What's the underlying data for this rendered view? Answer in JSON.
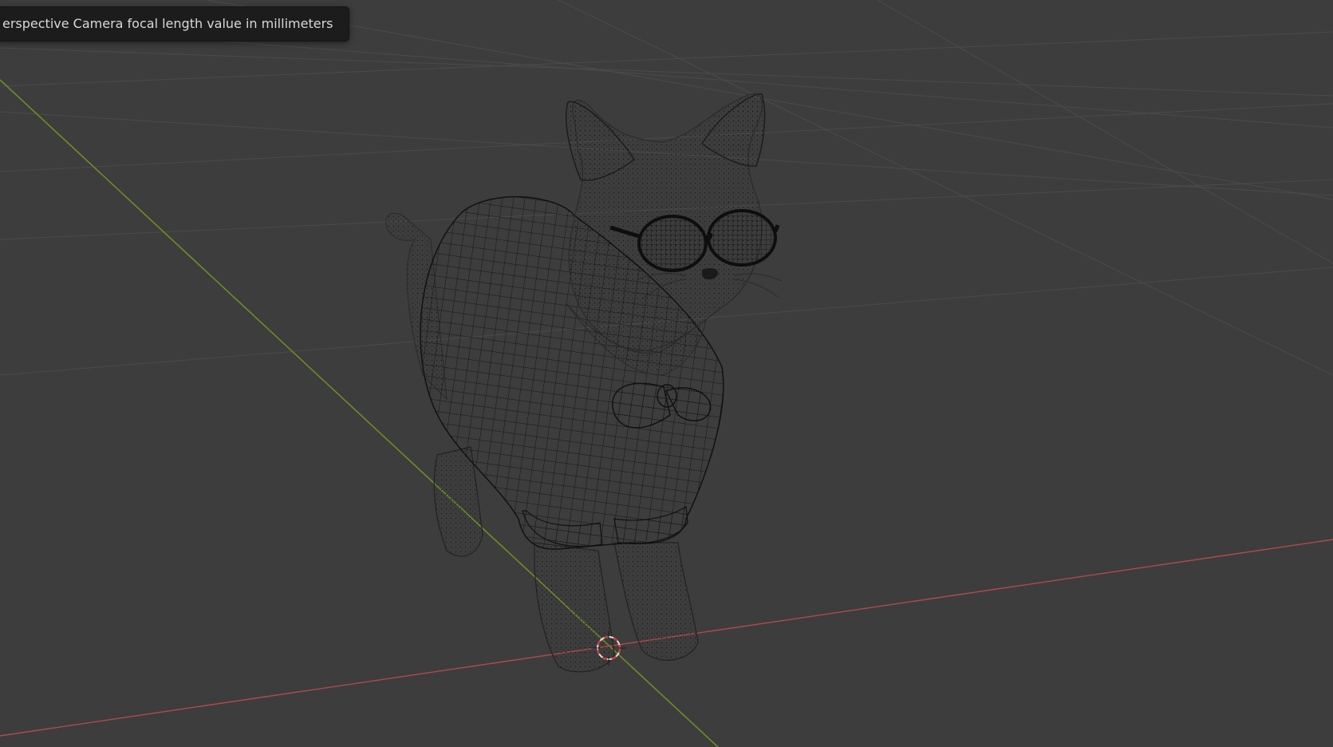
{
  "app": "Blender",
  "viewport": {
    "mode": "3d-viewport-wireframe",
    "background_color": "#3d3d3d",
    "grid_color": "#4a4a4a",
    "x_axis_color": "#b04a4a",
    "y_axis_color": "#6b8e23",
    "wire_color": "#151515",
    "object_name": "cat-with-sunglasses-and-bowtie",
    "cursor_icon": "3d-cursor-icon"
  },
  "tooltip": {
    "text": "erspective Camera focal length value in millimeters"
  }
}
